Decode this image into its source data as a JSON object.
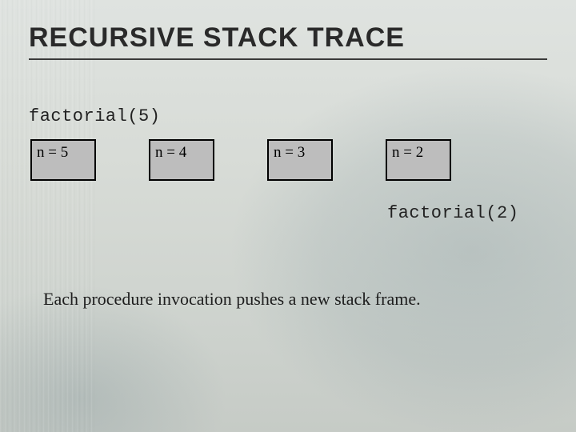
{
  "title": "RECURSIVE STACK TRACE",
  "call_top": "factorial(5)",
  "frames": [
    {
      "label": "n = 5"
    },
    {
      "label": "n = 4"
    },
    {
      "label": "n = 3"
    },
    {
      "label": "n = 2"
    }
  ],
  "call_bottom": "factorial(2)",
  "caption": "Each procedure invocation pushes a new stack frame."
}
